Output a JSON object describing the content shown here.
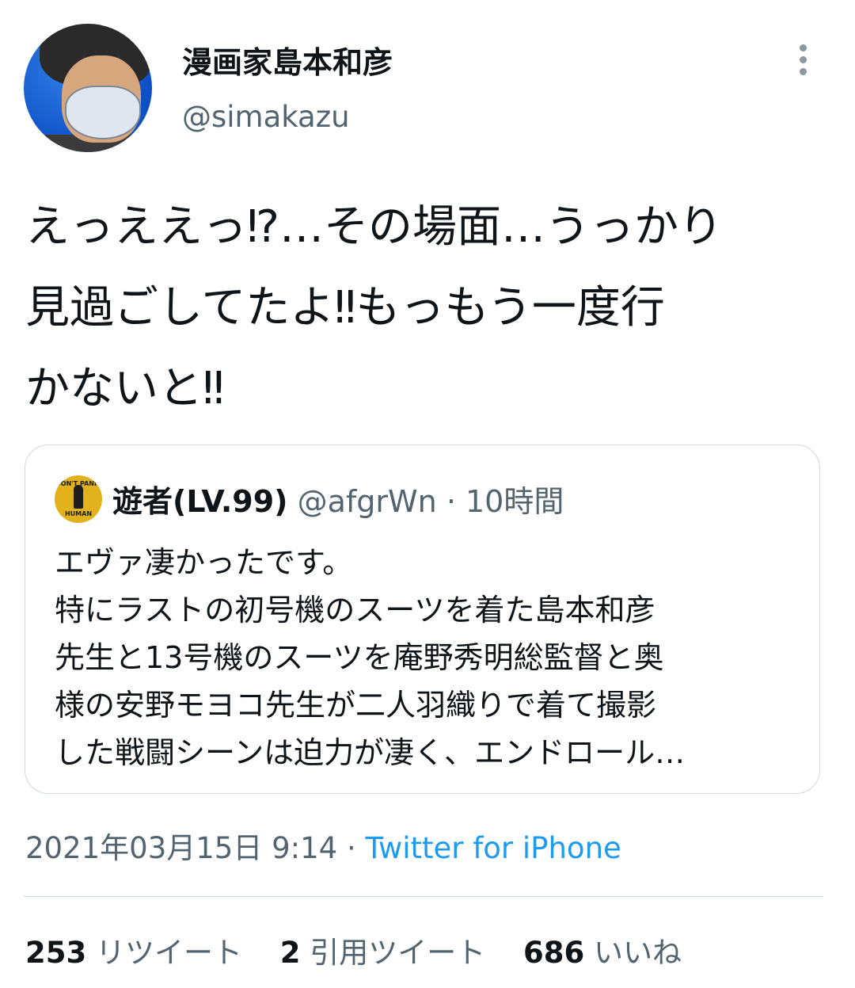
{
  "author": {
    "name": "漫画家島本和彦",
    "handle": "@simakazu"
  },
  "tweet_text": "えっええっ⁉…その場面…うっかり\n見過ごしてたよ‼もっもう一度行\nかないと‼",
  "quoted_tweet": {
    "avatar_text_top": "DON'T PANIC",
    "avatar_text_bottom": "HUMAN",
    "name": "遊者(LV.99)",
    "handle": "@afgrWn",
    "separator": "·",
    "time": "10時間",
    "text": "エヴァ凄かったです。\n特にラストの初号機のスーツを着た島本和彦\n先生と13号機のスーツを庵野秀明総監督と奥\n様の安野モヨコ先生が二人羽織りで着て撮影\nした戦闘シーンは迫力が凄く、エンドロール…"
  },
  "meta": {
    "datetime": "2021年03月15日 9:14",
    "separator": "·",
    "source": "Twitter for iPhone"
  },
  "stats": {
    "retweets_count": "253",
    "retweets_label": "リツイート",
    "quotes_count": "2",
    "quotes_label": "引用ツイート",
    "likes_count": "686",
    "likes_label": "いいね"
  },
  "colors": {
    "text": "#0f1419",
    "secondary": "#536471",
    "link": "#1d9bf0",
    "border": "#cfd9de"
  },
  "icons": [
    "more-vertical-icon"
  ]
}
